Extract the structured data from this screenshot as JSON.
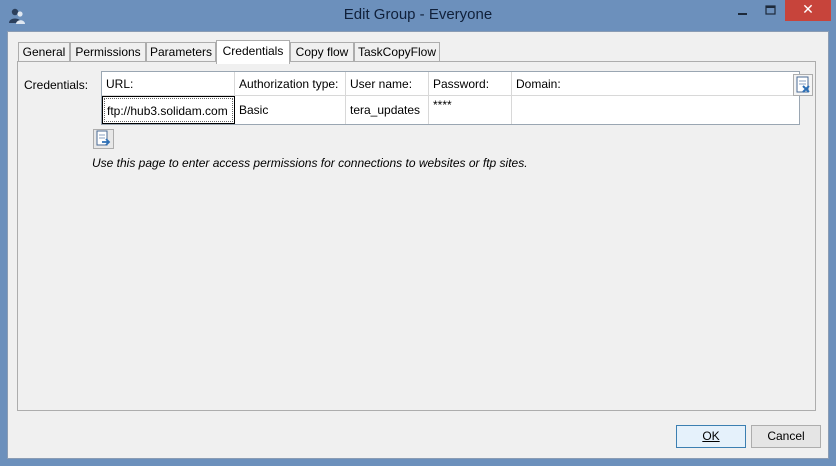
{
  "window": {
    "title": "Edit Group - Everyone",
    "close_glyph": "✕"
  },
  "tabs": [
    {
      "label": "General"
    },
    {
      "label": "Permissions"
    },
    {
      "label": "Parameters"
    },
    {
      "label": "Credentials",
      "active": true
    },
    {
      "label": "Copy flow"
    },
    {
      "label": "TaskCopyFlow"
    }
  ],
  "credentials": {
    "label": "Credentials:",
    "columns": [
      "URL:",
      "Authorization type:",
      "User name:",
      "Password:",
      "Domain:"
    ],
    "rows": [
      {
        "url": "ftp://hub3.solidam.com",
        "auth_type": "Basic",
        "user": "tera_updates",
        "password": "****",
        "domain": ""
      }
    ],
    "info": "Use this page to enter access permissions for connections to websites or ftp sites."
  },
  "buttons": {
    "ok": "OK",
    "cancel": "Cancel"
  },
  "colors": {
    "titlebar": "#6c90bc",
    "close": "#c7443b",
    "default_button_border": "#3c7fb1"
  }
}
